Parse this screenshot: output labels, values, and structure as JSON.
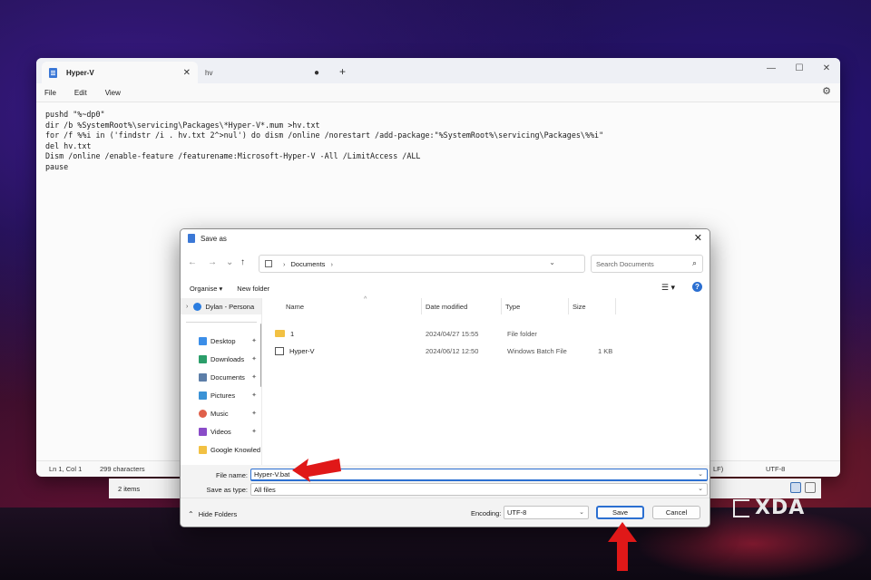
{
  "notepad": {
    "tabs": [
      {
        "label": "Hyper-V"
      },
      {
        "label": "hv"
      }
    ],
    "menu": [
      "File",
      "Edit",
      "View"
    ],
    "content": "pushd \"%~dp0\"\ndir /b %SystemRoot%\\servicing\\Packages\\*Hyper-V*.mum >hv.txt\nfor /f %%i in ('findstr /i . hv.txt 2^>nul') do dism /online /norestart /add-package:\"%SystemRoot%\\servicing\\Packages\\%%i\"\ndel hv.txt\nDism /online /enable-feature /featurename:Microsoft-Hyper-V -All /LimitAccess /ALL\npause",
    "status": {
      "position": "Ln 1, Col 1",
      "chars": "299 characters",
      "eol_fragment": "LF)",
      "encoding": "UTF-8"
    }
  },
  "explorer": {
    "items_count": "2 items"
  },
  "dialog": {
    "title": "Save as",
    "address": "Documents",
    "search_placeholder": "Search Documents",
    "toolbar": {
      "organise": "Organise ▾",
      "new_folder": "New folder"
    },
    "nav": [
      {
        "label": "Dylan - Persona",
        "icon": "cloud-icon",
        "pinned": false
      },
      {
        "label": "Desktop",
        "icon": "desktop-icon",
        "pinned": true
      },
      {
        "label": "Downloads",
        "icon": "download-icon",
        "pinned": true
      },
      {
        "label": "Documents",
        "icon": "documents-icon",
        "pinned": true
      },
      {
        "label": "Pictures",
        "icon": "pictures-icon",
        "pinned": true
      },
      {
        "label": "Music",
        "icon": "music-icon",
        "pinned": true
      },
      {
        "label": "Videos",
        "icon": "videos-icon",
        "pinned": true
      },
      {
        "label": "Google Knowled",
        "icon": "folder-icon",
        "pinned": false
      }
    ],
    "columns": [
      "Name",
      "Date modified",
      "Type",
      "Size"
    ],
    "files": [
      {
        "name": "1",
        "date": "2024/04/27 15:55",
        "type": "File folder",
        "size": "",
        "icon": "folder-icon"
      },
      {
        "name": "Hyper-V",
        "date": "2024/06/12 12:50",
        "type": "Windows Batch File",
        "size": "1 KB",
        "icon": "batch-file-icon"
      }
    ],
    "file_name_label": "File name:",
    "file_name_value": "Hyper-V.bat",
    "save_type_label": "Save as type:",
    "save_type_value": "All files",
    "hide_folders": "Hide Folders",
    "encoding_label": "Encoding:",
    "encoding_value": "UTF-8",
    "save_button": "Save",
    "cancel_button": "Cancel"
  },
  "watermark": "XDA",
  "colors": {
    "accent": "#2b6fd1",
    "arrow": "#e01818",
    "folder": "#f2c143"
  }
}
